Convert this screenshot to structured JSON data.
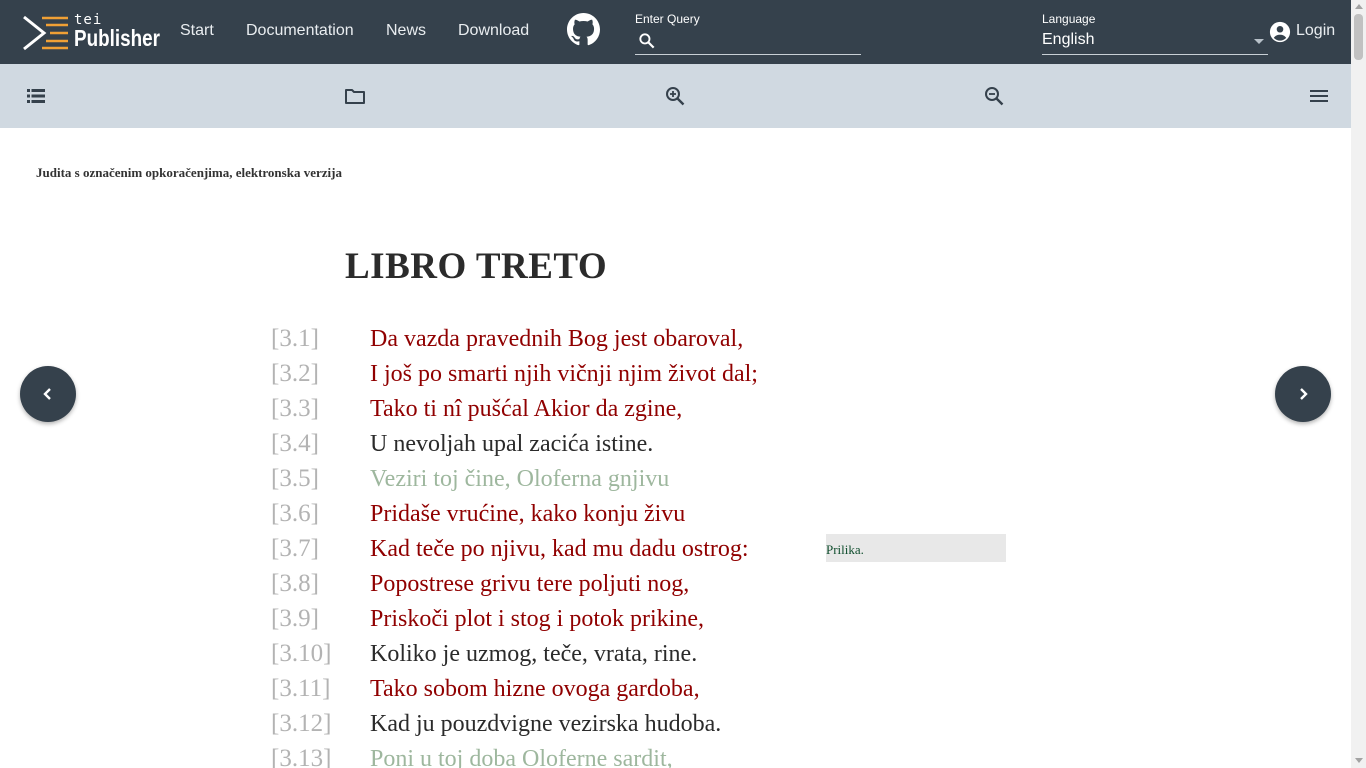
{
  "header": {
    "logo": {
      "small": "tei",
      "big": "Publisher"
    },
    "nav": [
      "Start",
      "Documentation",
      "News",
      "Download"
    ],
    "github_icon": "github-icon",
    "query": {
      "label": "Enter Query",
      "value": "",
      "placeholder": ""
    },
    "language": {
      "label": "Language",
      "value": "English"
    },
    "login": {
      "label": "Login"
    }
  },
  "toolbar": {
    "icons": [
      "toc-icon",
      "folder-icon",
      "zoom-in-icon",
      "zoom-out-icon",
      "menu-icon"
    ]
  },
  "document": {
    "title": "Judita s označenim opkoračenjima, elektronska verzija",
    "heading": "LIBRO TRETO",
    "verses": [
      {
        "num": "[3.1]",
        "text": "Da vazda pravednih Bog jest obaroval,",
        "color": "#900000"
      },
      {
        "num": "[3.2]",
        "text": "I još po smarti njih vičnji njim život dal;",
        "color": "#900000"
      },
      {
        "num": "[3.3]",
        "text": "Tako ti nî pušćal Akior da zgine,",
        "color": "#900000"
      },
      {
        "num": "[3.4]",
        "text": "U nevoljah upal zacića istine.",
        "color": "#2b2b2b"
      },
      {
        "num": "[3.5]",
        "text": "Veziri toj čine, Oloferna gnjivu",
        "color": "#9eb79e"
      },
      {
        "num": "[3.6]",
        "text": "Pridaše vrućine, kako konju živu",
        "color": "#900000"
      },
      {
        "num": "[3.7]",
        "text": "Kad teče po njivu, kad mu dadu ostrog:",
        "color": "#900000"
      },
      {
        "num": "[3.8]",
        "text": "Popostrese grivu tere poljuti nog,",
        "color": "#900000"
      },
      {
        "num": "[3.9]",
        "text": "Priskoči plot i stog i potok prikine,",
        "color": "#900000"
      },
      {
        "num": "[3.10]",
        "text": "Koliko je uzmog, teče, vrata, rine.",
        "color": "#2b2b2b"
      },
      {
        "num": "[3.11]",
        "text": "Tako sobom hizne ovoga gardoba,",
        "color": "#900000"
      },
      {
        "num": "[3.12]",
        "text": "Kad ju pouzdvigne vezirska hudoba.",
        "color": "#2b2b2b"
      },
      {
        "num": "[3.13]",
        "text": "Poni u toj doba Oloferne sardit,",
        "color": "#9eb79e"
      }
    ],
    "note": "Prilika."
  },
  "pagination": {
    "prev_icon": "chevron-left-icon",
    "next_icon": "chevron-right-icon"
  }
}
